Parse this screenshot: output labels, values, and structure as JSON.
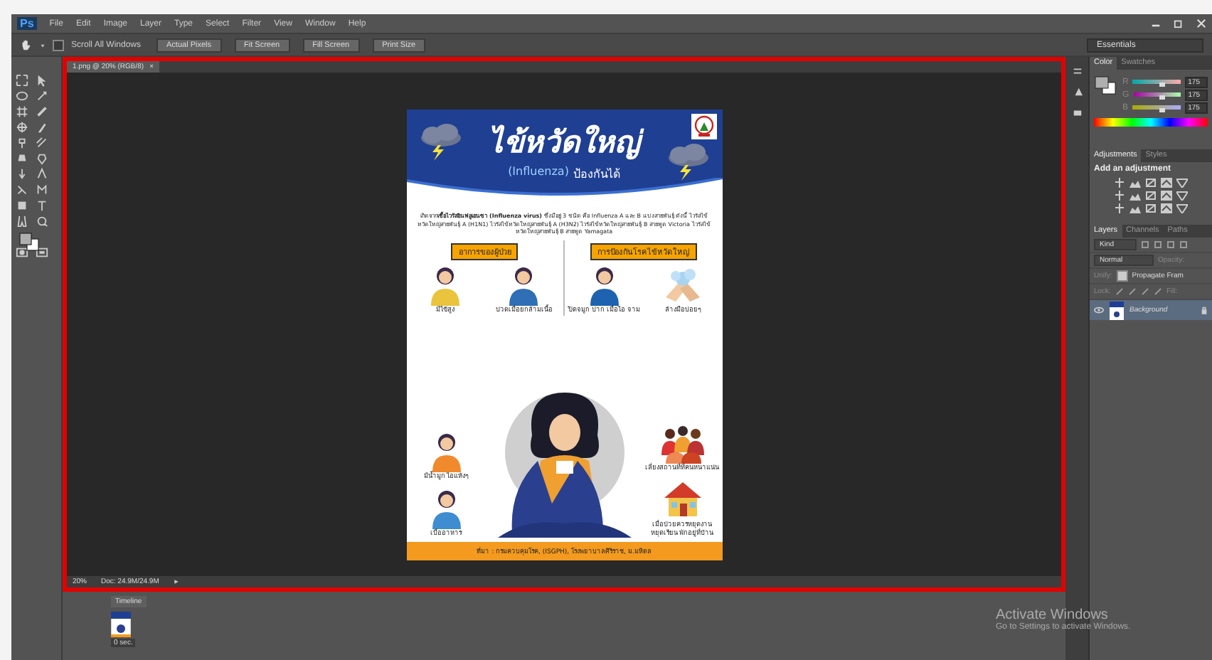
{
  "app": {
    "logo": "Ps",
    "menu": [
      "File",
      "Edit",
      "Image",
      "Layer",
      "Type",
      "Select",
      "Filter",
      "View",
      "Window",
      "Help"
    ]
  },
  "options_bar": {
    "scroll_all": {
      "label": "Scroll All Windows",
      "checked": false
    },
    "buttons": [
      "Actual Pixels",
      "Fit Screen",
      "Fill Screen",
      "Print Size"
    ],
    "workspace": "Essentials"
  },
  "document": {
    "tab": "1.png @ 20% (RGB/8)",
    "close": "×",
    "zoom": "20%",
    "doc_info": "Doc: 24.9M/24.9M"
  },
  "poster": {
    "title": "ไข้หวัดใหญ่",
    "subtitle_en": "(Influenza)",
    "subtitle_th": "ป้องกันได้",
    "intro": "เกิดจาก**เชื้อไวรัสอินฟลูเอนซา (Influenza virus)** ซึ่งมีอยู่ 3 ชนิด คือ Influenza A และ B แบ่งสายพันธุ์ ดังนี้ ไวรัสไข้หวัดใหญ่สายพันธุ์ A (H1N1) ไวรัสไข้หวัดใหญ่สายพันธุ์ A (H3N2) ไวรัสไข้หวัดใหญ่สายพันธุ์ B สายพูด Victoria ไวรัสไข้หวัดใหญ่สายพันธุ์ B สายพูด Yamagata",
    "symptoms_heading": "อาการของผู้ป่วย",
    "prevention_heading": "การป้องกันโรคไข้หวัดใหญ่",
    "symptoms": [
      {
        "caption": "มีไข้สูง",
        "kind": "person"
      },
      {
        "caption": "ปวดเมื่อยกล้ามเนื้อ",
        "kind": "person"
      },
      {
        "caption": "มีน้ำมูก ไอแห้งๆ",
        "kind": "person"
      },
      {
        "caption": "เบื่ออาหาร",
        "kind": "person"
      }
    ],
    "prevention": [
      {
        "caption": "ปิดจมูก ปาก เมื่อไอ จาม",
        "kind": "person"
      },
      {
        "caption": "ล้างมือบ่อยๆ",
        "kind": "hands"
      },
      {
        "caption": "เลี่ยงสถานที่ที่คนหนาแน่น",
        "kind": "crowd"
      },
      {
        "caption": "เมื่อป่วยควรหยุดงาน หยุดเรียน พักอยู่ที่บ้าน",
        "kind": "house"
      }
    ],
    "source": "ที่มา : กรมควบคุมโรค, (ISGPH), โรงพยาบาลศิริราช, ม.มหิดล"
  },
  "timeline": {
    "title": "Timeline",
    "frames": [
      {
        "duration": "0 sec."
      }
    ]
  },
  "panels": {
    "color": {
      "tabs": [
        {
          "label": "Color",
          "selected": true
        },
        {
          "label": "Swatches",
          "selected": false
        }
      ],
      "channels": [
        {
          "name": "R",
          "level": 0.62,
          "value": "175"
        },
        {
          "name": "G",
          "level": 0.62,
          "value": "175"
        },
        {
          "name": "B",
          "level": 0.62,
          "value": "175"
        }
      ]
    },
    "adjustments": {
      "tabs": [
        {
          "label": "Adjustments",
          "selected": true
        },
        {
          "label": "Styles",
          "selected": false
        }
      ],
      "hint": "Add an adjustment"
    },
    "layers": {
      "tabs": [
        {
          "label": "Layers",
          "selected": true
        },
        {
          "label": "Channels",
          "selected": false
        },
        {
          "label": "Paths",
          "selected": false
        }
      ],
      "filter": "Kind",
      "blend": "Normal",
      "opacity_label": "Opacity:",
      "unify_label": "Unify:",
      "propagate": {
        "label": "Propagate Fram",
        "checked": true
      },
      "lock_label": "Lock:",
      "fill_label": "Fill:",
      "items": [
        {
          "name": "Background",
          "selected": true
        }
      ]
    }
  },
  "activation": {
    "title": "Activate Windows",
    "text": "Go to Settings to activate Windows."
  }
}
